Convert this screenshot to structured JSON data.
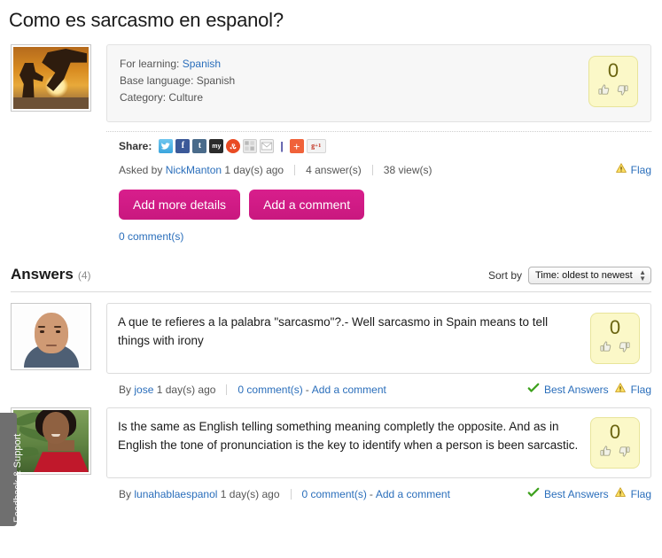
{
  "page": {
    "title": "Como es sarcasmo en espanol?"
  },
  "question": {
    "avatar_name": "sunset-silhouette-photo",
    "for_learning_label": "For learning:",
    "for_learning_value": "Spanish",
    "base_language_label": "Base language:",
    "base_language_value": "Spanish",
    "category_label": "Category:",
    "category_value": "Culture",
    "votes": "0",
    "share_label": "Share:",
    "share_icons": [
      {
        "name": "twitter-share-icon",
        "glyph": "✒"
      },
      {
        "name": "facebook-share-icon",
        "glyph": "f"
      },
      {
        "name": "tumblr-share-icon",
        "glyph": "t"
      },
      {
        "name": "myspace-share-icon",
        "glyph": "my"
      },
      {
        "name": "stumbleupon-share-icon",
        "glyph": "su"
      },
      {
        "name": "digg-share-icon",
        "glyph": ""
      },
      {
        "name": "email-share-icon",
        "glyph": "✉"
      },
      {
        "name": "addthis-share-icon",
        "glyph": "+"
      },
      {
        "name": "google-plus-one-icon",
        "glyph": "g+1"
      }
    ],
    "asked_by_label": "Asked by",
    "author": "NickManton",
    "time_ago": "1 day(s) ago",
    "answers_count": "4 answer(s)",
    "views_count": "38 view(s)",
    "flag_label": "Flag",
    "add_details_label": "Add more details",
    "add_comment_label": "Add a comment",
    "comments_label": "0 comment(s)"
  },
  "answers_section": {
    "title": "Answers",
    "count": "(4)",
    "sort_by_label": "Sort by",
    "sort_selected": "Time: oldest to newest",
    "sort_options": [
      "Time: oldest to newest"
    ]
  },
  "answers": [
    {
      "avatar_name": "bald-man-portrait",
      "text": "A que te refieres a la palabra \"sarcasmo\"?.- Well sarcasmo in Spain means to tell things with irony",
      "votes": "0",
      "by_label": "By",
      "author": "jose",
      "time_ago": "1 day(s) ago",
      "comments_label": "0 comment(s)",
      "dash": "-",
      "add_comment_label": "Add a comment",
      "best_answers_label": "Best Answers",
      "flag_label": "Flag"
    },
    {
      "avatar_name": "woman-red-dress-portrait",
      "text": "Is the same as English telling something meaning completly the opposite. And as in English the tone of pronunciation is the key to identify when a person is been sarcastic.",
      "votes": "0",
      "by_label": "By",
      "author": "lunahablaespanol",
      "time_ago": "1 day(s) ago",
      "comments_label": "0 comment(s)",
      "dash": "-",
      "add_comment_label": "Add a comment",
      "best_answers_label": "Best Answers",
      "flag_label": "Flag"
    }
  ],
  "feedback_tab": {
    "label": "Feedback & Support"
  },
  "colors": {
    "accent_pink": "#d81e8c",
    "link_blue": "#2a6ebb",
    "vote_yellow": "#fbf8c8",
    "panel_grey": "#f7f7f7"
  }
}
